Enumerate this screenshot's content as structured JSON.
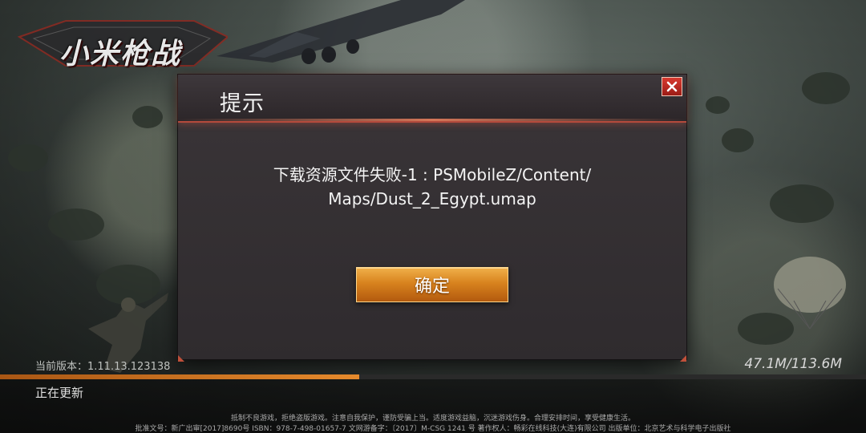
{
  "game": {
    "logo_text": "小米枪战"
  },
  "dialog": {
    "title": "提示",
    "message_line1": "下载资源文件失败-1 : PSMobileZ/Content/",
    "message_line2": "Maps/Dust_2_Egypt.umap",
    "confirm_label": "确定",
    "close_icon": "close-icon"
  },
  "status": {
    "version_label": "当前版本：1.11.13.123138",
    "progress_text": "47.1M/113.6M",
    "progress_fraction": 0.415,
    "status_text": "正在更新"
  },
  "footer": {
    "line1": "抵制不良游戏，拒绝盗版游戏。注意自我保护，谨防受骗上当。适度游戏益脑，沉迷游戏伤身。合理安排时间，享受健康生活。",
    "line2": "批准文号：新广出审[2017]8690号    ISBN：978-7-498-01657-7    文网游备字：〔2017〕M-CSG 1241 号    著作权人：畅彩在线科技(大连)有限公司    出版单位：北京艺术与科学电子出版社"
  },
  "colors": {
    "accent": "#d8831e",
    "close_red": "#c82a22",
    "header_line": "#b44a3c"
  }
}
